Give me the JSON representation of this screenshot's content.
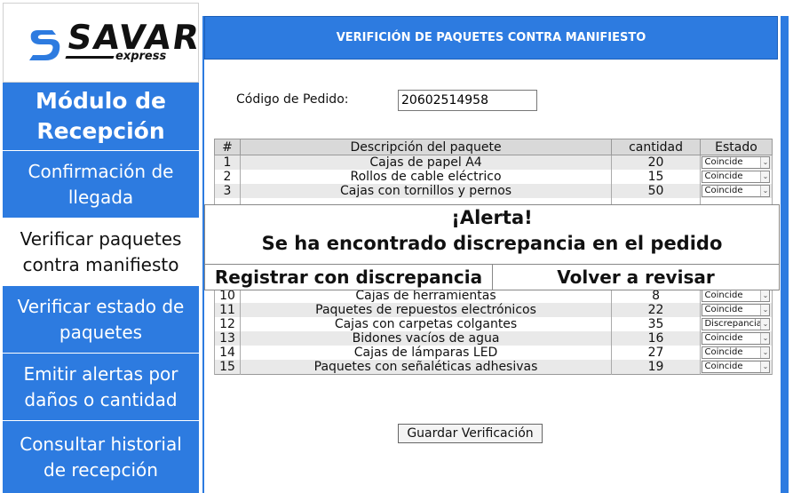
{
  "brand": {
    "name": "SAVAR",
    "tagline": "express"
  },
  "sidebar": {
    "title": "Módulo de Recepción",
    "items": [
      {
        "label": "Confirmación de llegada"
      },
      {
        "label": "Verificar paquetes contra manifiesto"
      },
      {
        "label": "Verificar estado de paquetes"
      },
      {
        "label": "Emitir alertas por daños o cantidad"
      },
      {
        "label": "Consultar historial de recepción"
      }
    ]
  },
  "header": {
    "title": "VERIFICIÓN DE PAQUETES CONTRA MANIFIESTO"
  },
  "form": {
    "order_label": "Código de Pedido:",
    "order_value": "20602514958"
  },
  "table": {
    "headers": [
      "#",
      "Descripción del paquete",
      "cantidad",
      "Estado"
    ],
    "rows": [
      {
        "n": "1",
        "desc": "Cajas de papel A4",
        "qty": "20",
        "state": "Coincide"
      },
      {
        "n": "2",
        "desc": "Rollos de cable eléctrico",
        "qty": "15",
        "state": "Coincide"
      },
      {
        "n": "3",
        "desc": "Cajas con tornillos y pernos",
        "qty": "50",
        "state": "Coincide"
      },
      {
        "n": "10",
        "desc": "Cajas de herramientas",
        "qty": "8",
        "state": "Coincide"
      },
      {
        "n": "11",
        "desc": "Paquetes de repuestos electrónicos",
        "qty": "22",
        "state": "Coincide"
      },
      {
        "n": "12",
        "desc": "Cajas con carpetas colgantes",
        "qty": "35",
        "state": "Discrepancia"
      },
      {
        "n": "13",
        "desc": "Bidones vacíos de agua",
        "qty": "16",
        "state": "Coincide"
      },
      {
        "n": "14",
        "desc": "Cajas de lámparas LED",
        "qty": "27",
        "state": "Coincide"
      },
      {
        "n": "15",
        "desc": "Paquetes con señaléticas adhesivas",
        "qty": "19",
        "state": "Coincide"
      }
    ]
  },
  "alert": {
    "title": "¡Alerta!",
    "message": "Se ha encontrado discrepancia en el pedido",
    "btn_register": "Registrar con discrepancia",
    "btn_review": "Volver a revisar"
  },
  "actions": {
    "save_label": "Guardar Verificación"
  },
  "colors": {
    "accent": "#2d7be0"
  }
}
